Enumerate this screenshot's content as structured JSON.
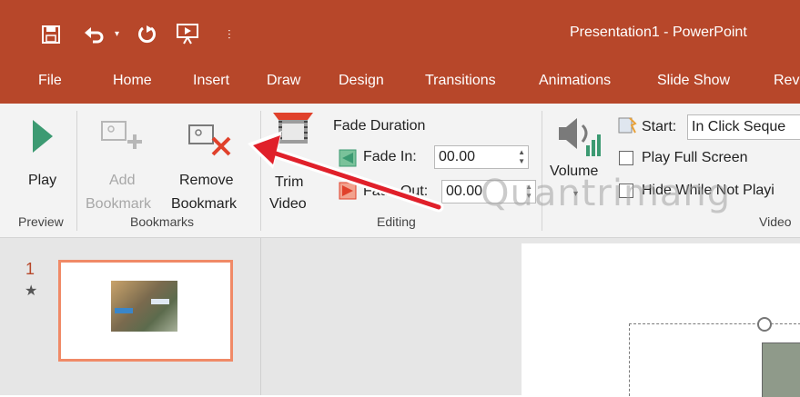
{
  "window": {
    "title": "Presentation1 - PowerPoint"
  },
  "qat": {
    "customize_glyph": "⫶"
  },
  "tabs": [
    "File",
    "Home",
    "Insert",
    "Draw",
    "Design",
    "Transitions",
    "Animations",
    "Slide Show",
    "Rev"
  ],
  "ribbon": {
    "preview": {
      "play_label": "Play",
      "group": "Preview"
    },
    "bookmarks": {
      "add_line1": "Add",
      "add_line2": "Bookmark",
      "remove_line1": "Remove",
      "remove_line2": "Bookmark",
      "group": "Bookmarks"
    },
    "editing": {
      "trim_line1": "Trim",
      "trim_line2": "Video",
      "fade_duration": "Fade Duration",
      "fade_in_label": "Fade In:",
      "fade_in_value": "00.00",
      "fade_out_label": "Fade Out:",
      "fade_out_value": "00.00",
      "group": "Editing"
    },
    "video_options": {
      "volume": "Volume",
      "start_label": "Start:",
      "start_value": "In Click Seque",
      "play_full_screen": "Play Full Screen",
      "hide_while": "Hide While Not Playi",
      "group": "Video"
    }
  },
  "slides": {
    "number": "1",
    "animation_mark": "★"
  },
  "watermark": "Quantrimang",
  "colors": {
    "accent": "#b7472a",
    "play_green": "#3c9a72",
    "remove_red": "#e0412b",
    "thumb_border": "#f08a67"
  }
}
